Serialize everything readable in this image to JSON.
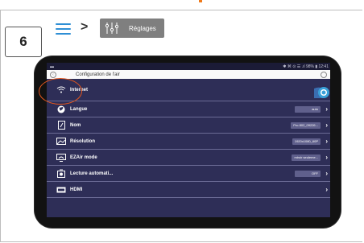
{
  "step": {
    "number": "6"
  },
  "breadcrumb": {
    "separator": ">",
    "settings_label": "Réglages"
  },
  "statusbar": {
    "left": "▬",
    "right": "✱ ⌘ ⊙ ☰ .ıl 98% ▮ 12:41"
  },
  "config": {
    "title": "Configuration de l'air"
  },
  "rows": [
    {
      "label": "Internet",
      "value": ""
    },
    {
      "label": "Langue",
      "value": "auto"
    },
    {
      "label": "Nom",
      "value": "Pro 802_09226..."
    },
    {
      "label": "Résolution",
      "value": "1920x1080_60P"
    },
    {
      "label": "EZAir mode",
      "value": "miroir seuleme..."
    },
    {
      "label": "Lecture automati...",
      "value": "OFF"
    },
    {
      "label": "HDMI",
      "value": ""
    }
  ],
  "colors": {
    "accent": "#2f8fd5",
    "annotation": "#e3561d",
    "screen_bg": "#2e2e57"
  }
}
